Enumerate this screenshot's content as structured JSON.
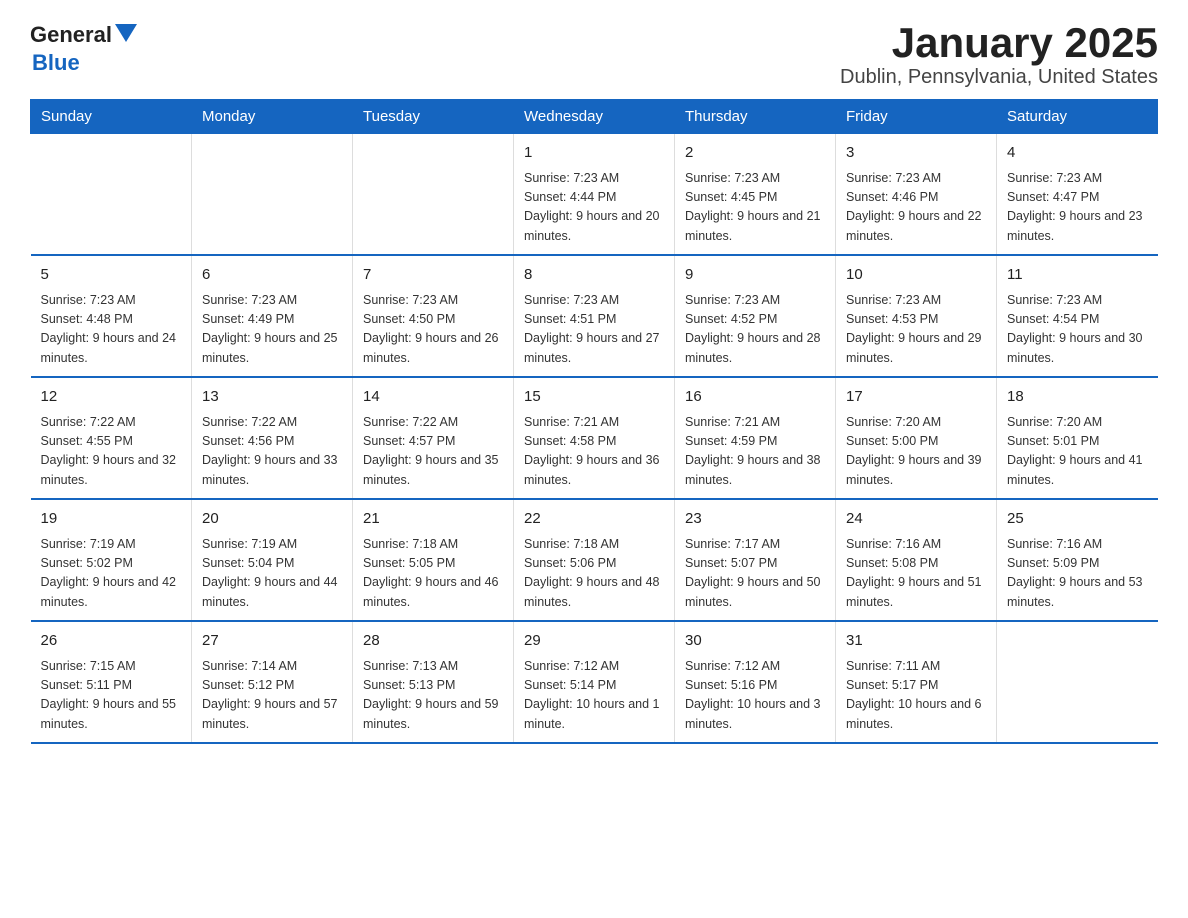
{
  "header": {
    "logo_general": "General",
    "logo_blue": "Blue",
    "title": "January 2025",
    "subtitle": "Dublin, Pennsylvania, United States"
  },
  "weekdays": [
    "Sunday",
    "Monday",
    "Tuesday",
    "Wednesday",
    "Thursday",
    "Friday",
    "Saturday"
  ],
  "weeks": [
    [
      {
        "day": "",
        "info": ""
      },
      {
        "day": "",
        "info": ""
      },
      {
        "day": "",
        "info": ""
      },
      {
        "day": "1",
        "info": "Sunrise: 7:23 AM\nSunset: 4:44 PM\nDaylight: 9 hours\nand 20 minutes."
      },
      {
        "day": "2",
        "info": "Sunrise: 7:23 AM\nSunset: 4:45 PM\nDaylight: 9 hours\nand 21 minutes."
      },
      {
        "day": "3",
        "info": "Sunrise: 7:23 AM\nSunset: 4:46 PM\nDaylight: 9 hours\nand 22 minutes."
      },
      {
        "day": "4",
        "info": "Sunrise: 7:23 AM\nSunset: 4:47 PM\nDaylight: 9 hours\nand 23 minutes."
      }
    ],
    [
      {
        "day": "5",
        "info": "Sunrise: 7:23 AM\nSunset: 4:48 PM\nDaylight: 9 hours\nand 24 minutes."
      },
      {
        "day": "6",
        "info": "Sunrise: 7:23 AM\nSunset: 4:49 PM\nDaylight: 9 hours\nand 25 minutes."
      },
      {
        "day": "7",
        "info": "Sunrise: 7:23 AM\nSunset: 4:50 PM\nDaylight: 9 hours\nand 26 minutes."
      },
      {
        "day": "8",
        "info": "Sunrise: 7:23 AM\nSunset: 4:51 PM\nDaylight: 9 hours\nand 27 minutes."
      },
      {
        "day": "9",
        "info": "Sunrise: 7:23 AM\nSunset: 4:52 PM\nDaylight: 9 hours\nand 28 minutes."
      },
      {
        "day": "10",
        "info": "Sunrise: 7:23 AM\nSunset: 4:53 PM\nDaylight: 9 hours\nand 29 minutes."
      },
      {
        "day": "11",
        "info": "Sunrise: 7:23 AM\nSunset: 4:54 PM\nDaylight: 9 hours\nand 30 minutes."
      }
    ],
    [
      {
        "day": "12",
        "info": "Sunrise: 7:22 AM\nSunset: 4:55 PM\nDaylight: 9 hours\nand 32 minutes."
      },
      {
        "day": "13",
        "info": "Sunrise: 7:22 AM\nSunset: 4:56 PM\nDaylight: 9 hours\nand 33 minutes."
      },
      {
        "day": "14",
        "info": "Sunrise: 7:22 AM\nSunset: 4:57 PM\nDaylight: 9 hours\nand 35 minutes."
      },
      {
        "day": "15",
        "info": "Sunrise: 7:21 AM\nSunset: 4:58 PM\nDaylight: 9 hours\nand 36 minutes."
      },
      {
        "day": "16",
        "info": "Sunrise: 7:21 AM\nSunset: 4:59 PM\nDaylight: 9 hours\nand 38 minutes."
      },
      {
        "day": "17",
        "info": "Sunrise: 7:20 AM\nSunset: 5:00 PM\nDaylight: 9 hours\nand 39 minutes."
      },
      {
        "day": "18",
        "info": "Sunrise: 7:20 AM\nSunset: 5:01 PM\nDaylight: 9 hours\nand 41 minutes."
      }
    ],
    [
      {
        "day": "19",
        "info": "Sunrise: 7:19 AM\nSunset: 5:02 PM\nDaylight: 9 hours\nand 42 minutes."
      },
      {
        "day": "20",
        "info": "Sunrise: 7:19 AM\nSunset: 5:04 PM\nDaylight: 9 hours\nand 44 minutes."
      },
      {
        "day": "21",
        "info": "Sunrise: 7:18 AM\nSunset: 5:05 PM\nDaylight: 9 hours\nand 46 minutes."
      },
      {
        "day": "22",
        "info": "Sunrise: 7:18 AM\nSunset: 5:06 PM\nDaylight: 9 hours\nand 48 minutes."
      },
      {
        "day": "23",
        "info": "Sunrise: 7:17 AM\nSunset: 5:07 PM\nDaylight: 9 hours\nand 50 minutes."
      },
      {
        "day": "24",
        "info": "Sunrise: 7:16 AM\nSunset: 5:08 PM\nDaylight: 9 hours\nand 51 minutes."
      },
      {
        "day": "25",
        "info": "Sunrise: 7:16 AM\nSunset: 5:09 PM\nDaylight: 9 hours\nand 53 minutes."
      }
    ],
    [
      {
        "day": "26",
        "info": "Sunrise: 7:15 AM\nSunset: 5:11 PM\nDaylight: 9 hours\nand 55 minutes."
      },
      {
        "day": "27",
        "info": "Sunrise: 7:14 AM\nSunset: 5:12 PM\nDaylight: 9 hours\nand 57 minutes."
      },
      {
        "day": "28",
        "info": "Sunrise: 7:13 AM\nSunset: 5:13 PM\nDaylight: 9 hours\nand 59 minutes."
      },
      {
        "day": "29",
        "info": "Sunrise: 7:12 AM\nSunset: 5:14 PM\nDaylight: 10 hours\nand 1 minute."
      },
      {
        "day": "30",
        "info": "Sunrise: 7:12 AM\nSunset: 5:16 PM\nDaylight: 10 hours\nand 3 minutes."
      },
      {
        "day": "31",
        "info": "Sunrise: 7:11 AM\nSunset: 5:17 PM\nDaylight: 10 hours\nand 6 minutes."
      },
      {
        "day": "",
        "info": ""
      }
    ]
  ]
}
